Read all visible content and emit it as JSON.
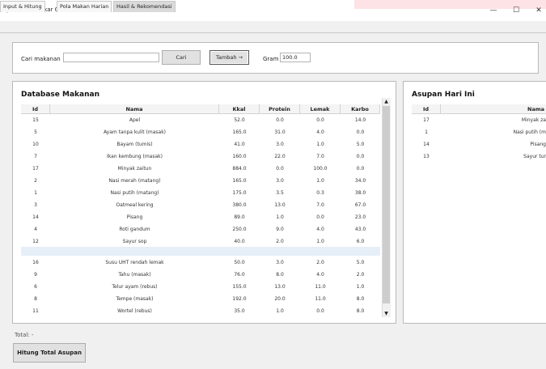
{
  "window": {
    "title": "Sistem Pakar Gizi Ibu Hamil",
    "minimize": "—",
    "maximize": "☐",
    "close": "✕"
  },
  "tabs": [
    {
      "label": "Input & Hitung"
    },
    {
      "label": "Pola Makan Harian"
    },
    {
      "label": "Hasil & Rekomendasi"
    }
  ],
  "search": {
    "label": "Cari makanan",
    "value": "",
    "button": "Cari",
    "add_button": "Tambah →",
    "gram_label": "Gram",
    "gram_value": "100.0"
  },
  "database": {
    "title": "Database Makanan",
    "columns": [
      "Id",
      "Nama",
      "Kkal",
      "Protein",
      "Lemak",
      "Karbo"
    ],
    "rows": [
      [
        "15",
        "Apel",
        "52.0",
        "0.0",
        "0.0",
        "14.0"
      ],
      [
        "5",
        "Ayam tanpa kulit (masak)",
        "165.0",
        "31.0",
        "4.0",
        "0.0"
      ],
      [
        "10",
        "Bayam (tumis)",
        "41.0",
        "3.0",
        "1.0",
        "5.0"
      ],
      [
        "7",
        "Ikan kembung (masak)",
        "160.0",
        "22.0",
        "7.0",
        "0.0"
      ],
      [
        "17",
        "Minyak zaitun",
        "884.0",
        "0.0",
        "100.0",
        "0.0"
      ],
      [
        "2",
        "Nasi merah (matang)",
        "165.0",
        "3.0",
        "1.0",
        "34.0"
      ],
      [
        "1",
        "Nasi putih (matang)",
        "175.0",
        "3.5",
        "0.3",
        "38.0"
      ],
      [
        "3",
        "Oatmeal kering",
        "380.0",
        "13.0",
        "7.0",
        "67.0"
      ],
      [
        "14",
        "Pisang",
        "89.0",
        "1.0",
        "0.0",
        "23.0"
      ],
      [
        "4",
        "Roti gandum",
        "250.0",
        "9.0",
        "4.0",
        "43.0"
      ],
      [
        "12",
        "Sayur sop",
        "40.0",
        "2.0",
        "1.0",
        "6.0"
      ],
      [
        "16",
        "Susu UHT rendah lemak",
        "50.0",
        "3.0",
        "2.0",
        "5.0"
      ],
      [
        "9",
        "Tahu (masak)",
        "76.0",
        "8.0",
        "4.0",
        "2.0"
      ],
      [
        "6",
        "Telur ayam (rebus)",
        "155.0",
        "13.0",
        "11.0",
        "1.0"
      ],
      [
        "8",
        "Tempe (masak)",
        "192.0",
        "20.0",
        "11.0",
        "8.0"
      ],
      [
        "11",
        "Wortel (rebus)",
        "35.0",
        "1.0",
        "0.0",
        "8.0"
      ]
    ]
  },
  "intake": {
    "title": "Asupan Hari Ini",
    "columns": [
      "Id",
      "Nama"
    ],
    "rows": [
      [
        "17",
        "Minyak za"
      ],
      [
        "1",
        "Nasi putih (m"
      ],
      [
        "14",
        "Pisang"
      ],
      [
        "13",
        "Sayur tur"
      ]
    ]
  },
  "footer": {
    "total_text": "Total: -",
    "calc_button": "Hitung Total Asupan"
  },
  "icons": {
    "app": "feather-icon",
    "scroll_up": "▲",
    "scroll_down": "▼"
  }
}
